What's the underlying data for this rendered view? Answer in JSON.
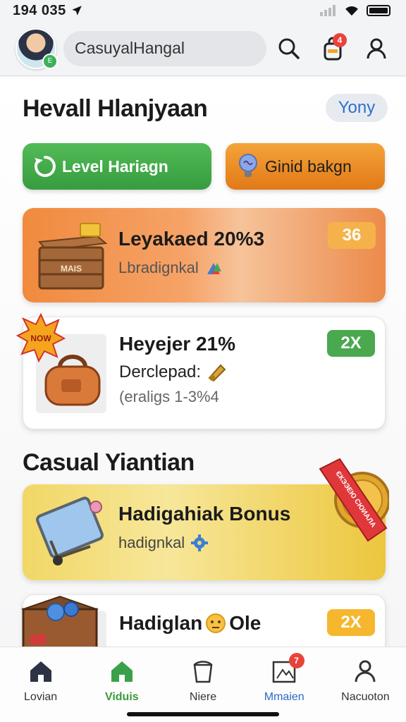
{
  "status_bar": {
    "time": "194 035"
  },
  "header": {
    "avatar_badge": "E",
    "search_value": "CasuyalHangal",
    "notification_count": "4"
  },
  "section1": {
    "title": "Hevall Hlanjyaan",
    "tag": "Yony"
  },
  "quick_actions": [
    {
      "label": "Level Hariagn",
      "icon": "refresh-icon",
      "color": "#43a94a"
    },
    {
      "label": "Ginid bakgn",
      "icon": "lightbulb-icon",
      "color": "#ea8a26"
    }
  ],
  "cards": [
    {
      "title": "Leyakaed 20%3",
      "subtitle": "Lbradignkal",
      "badge": "36",
      "badge_color": "#f6b24a",
      "chest_label": "MAIS"
    },
    {
      "title": "Heyejer 21%",
      "subtitle": "Derclepad:",
      "detail": "(eraligs 1-3%4",
      "badge": "2X",
      "badge_color": "#4aa84e",
      "burst_label": "NOW"
    },
    {
      "title": "Hadigahiak Bonus",
      "subtitle": "hadignkal",
      "ribbon": "ЄКЭЭЕЮ СЮИАЛА",
      "badge_color": "#e0383a"
    },
    {
      "title": "Hadiglan",
      "title_suffix": "Ole",
      "badge": "2X",
      "badge_color": "#f6b72e"
    }
  ],
  "section2": {
    "title": "Casual Yiantian"
  },
  "bottom_nav": [
    {
      "label": "Lovian",
      "icon": "home-icon"
    },
    {
      "label": "Viduis",
      "icon": "home-icon"
    },
    {
      "label": "Niere",
      "icon": "basket-icon"
    },
    {
      "label": "Mmaien",
      "icon": "frame-icon",
      "badge": "7"
    },
    {
      "label": "Nacuoton",
      "icon": "profile-icon"
    }
  ]
}
